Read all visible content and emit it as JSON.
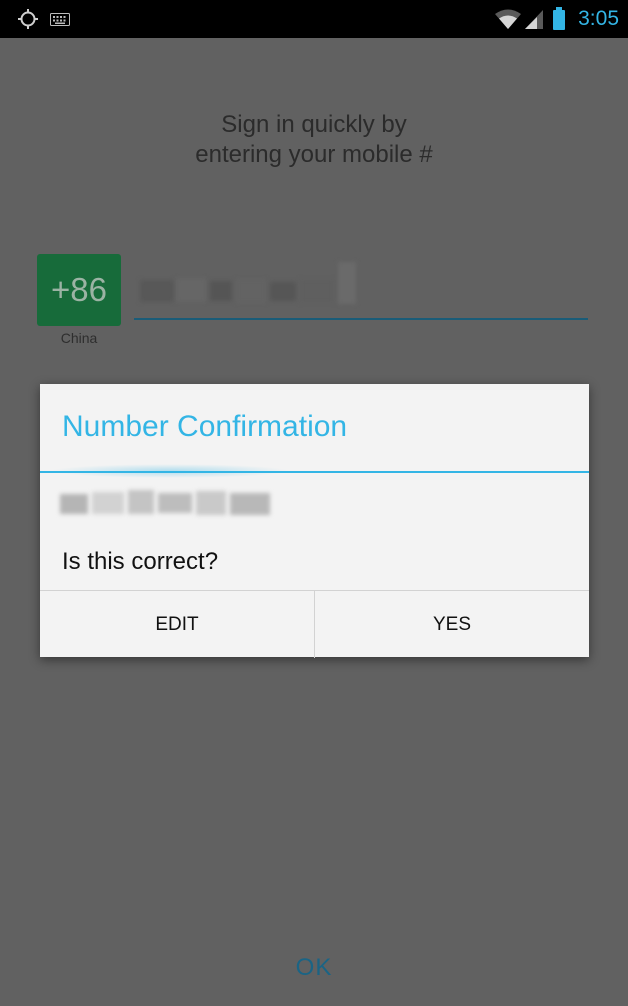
{
  "status_bar": {
    "time": "3:05",
    "icons": [
      "gps-icon",
      "keyboard-icon",
      "wifi-icon",
      "signal-icon",
      "battery-icon"
    ],
    "accent_color": "#33b5e5"
  },
  "sign_in": {
    "prompt": "Sign in quickly by\nentering your mobile #",
    "country_code": "+86",
    "country_name": "China",
    "number_obscured": true,
    "ok_label": "OK"
  },
  "dialog": {
    "title": "Number Confirmation",
    "number_obscured": true,
    "question": "Is this correct?",
    "edit_label": "EDIT",
    "yes_label": "YES"
  },
  "colors": {
    "dialog_accent": "#33b5e5",
    "country_box": "#176b3a",
    "scrim_background": "#616161"
  }
}
